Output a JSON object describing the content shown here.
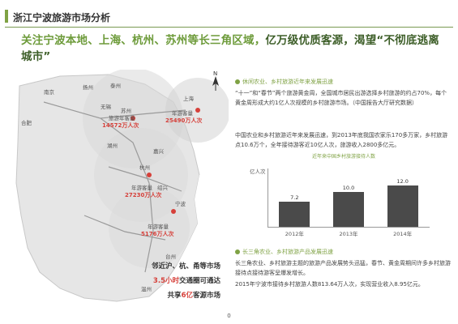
{
  "header": {
    "title": "浙江宁波旅游市场分析"
  },
  "headline": {
    "part1": "关注宁波本地、上海、杭州、苏州等长三角区域，",
    "part2": "亿万级优质客源，渴望“不彻底逃离城市”"
  },
  "map": {
    "cities": [
      "南京",
      "扬州",
      "泰州",
      "苏州",
      "无锡",
      "上海",
      "杭州",
      "宁波",
      "台州",
      "温州",
      "湖州",
      "嘉兴",
      "合肥",
      "绍兴"
    ],
    "stats": [
      "14572万人次",
      "25490万人次",
      "27230万人次",
      "5176万人次"
    ],
    "stat_labels": [
      "旅游年客量",
      "年游客量",
      "年游客量",
      "年游客量"
    ],
    "north_label": "N",
    "text": {
      "line1": "邻近沪、杭、甬等市场",
      "line2_red": "3.5小时",
      "line2_dark": "交通圈可通达",
      "line3_pre": "共享",
      "line3_red": "6亿",
      "line3_post": "客源市场"
    }
  },
  "section1": {
    "heading": "休闲农业、乡村旅游近年来发展迅速",
    "para1": "“十一”和“春节”两个旅游黄金周，全国城市居民出游选择乡村旅游的约占70%，每个黄金周形成大约1亿人次规模的乡村旅游市场。（中国报告大厅研究数据）",
    "para2": "中国农业和乡村旅游近年来发展迅速，到2013年底我国农家乐170多万家，乡村旅游点10.6万个，全年接待游客近10亿人次，旅游收入2800多亿元。"
  },
  "chart_data": {
    "type": "bar",
    "title": "近年来中国乡村旅游接待人数",
    "ylabel": "亿人次",
    "categories": [
      "2012年",
      "2013年",
      "2014年"
    ],
    "values": [
      7.2,
      10.0,
      12.0
    ],
    "ylim": [
      0,
      14
    ]
  },
  "section2": {
    "heading": "长三角农业、乡村旅游产品发展迅速",
    "para1": "长三角农业、乡村旅游主题的旅游产品发展势头迅猛，春节、黄金周期间许多乡村旅游接待点接待游客呈爆发增长。",
    "para2": "2015年宁波市接待乡村旅游人数813.64万人次，实现营业收入8.95亿元。"
  },
  "footer": {
    "page": "0"
  }
}
